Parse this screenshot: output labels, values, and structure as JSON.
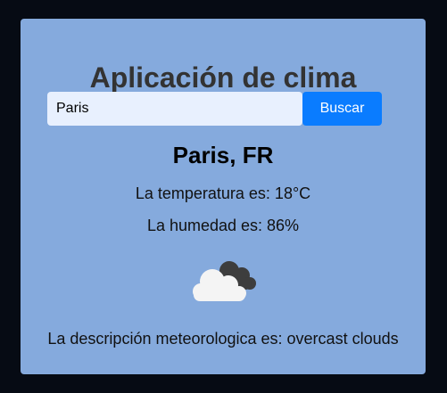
{
  "app": {
    "title": "Aplicación de clima"
  },
  "search": {
    "value": "Paris",
    "button_label": "Buscar"
  },
  "weather": {
    "city": "Paris, FR",
    "temperature_text": "La temperatura es: 18°C",
    "humidity_text": "La humedad es: 86%",
    "icon": "overcast-clouds-icon",
    "description_text": "La descripción meteorologica es: overcast clouds"
  },
  "colors": {
    "page_background": "#060b14",
    "card_background": "#85aadd",
    "title_text": "#333333",
    "input_background": "#e8f0fe",
    "button_background": "#0a7cff"
  }
}
